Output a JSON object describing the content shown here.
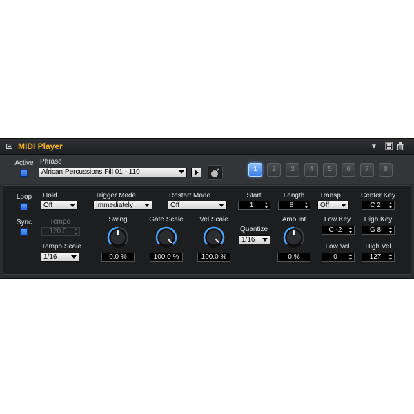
{
  "window": {
    "title": "MIDI Player"
  },
  "header": {
    "active_label": "Active",
    "phrase_label": "Phrase",
    "phrase_value": "African Percussions Fill 01 - 110",
    "slots": [
      "1",
      "2",
      "3",
      "4",
      "5",
      "6",
      "7",
      "8"
    ],
    "active_slot": "1"
  },
  "controls": {
    "loop_label": "Loop",
    "sync_label": "Sync",
    "hold_label": "Hold",
    "hold_value": "Off",
    "tempo_label": "Tempo",
    "tempo_value": "120.0",
    "tempo_scale_label": "Tempo Scale",
    "tempo_scale_value": "1/16",
    "trigger_mode_label": "Trigger Mode",
    "trigger_mode_value": "Immediately",
    "restart_mode_label": "Restart Mode",
    "restart_mode_value": "Off",
    "swing_label": "Swing",
    "swing_value": "0.0 %",
    "gate_scale_label": "Gate Scale",
    "gate_scale_value": "100.0 %",
    "vel_scale_label": "Vel Scale",
    "vel_scale_value": "100.0 %",
    "quantize_label": "Quantize",
    "quantize_value": "1/16",
    "start_label": "Start",
    "start_value": "1",
    "length_label": "Length",
    "length_value": "8",
    "amount_label": "Amount",
    "amount_value": "0 %",
    "transp_label": "Transp",
    "transp_value": "Off",
    "center_key_label": "Center Key",
    "center_key_value": "C 2",
    "low_key_label": "Low Key",
    "low_key_value": "C -2",
    "high_key_label": "High Key",
    "high_key_value": "G 8",
    "low_vel_label": "Low Vel",
    "low_vel_value": "0",
    "high_vel_label": "High Vel",
    "high_vel_value": "127"
  },
  "knob_levels": {
    "swing": 0.5,
    "gate_scale": 1.0,
    "vel_scale": 1.0,
    "amount": 0.5
  },
  "colors": {
    "accent": "#f0b020",
    "active_blue": "#3a7ee8",
    "knob_arc": "#4aa3ff"
  }
}
